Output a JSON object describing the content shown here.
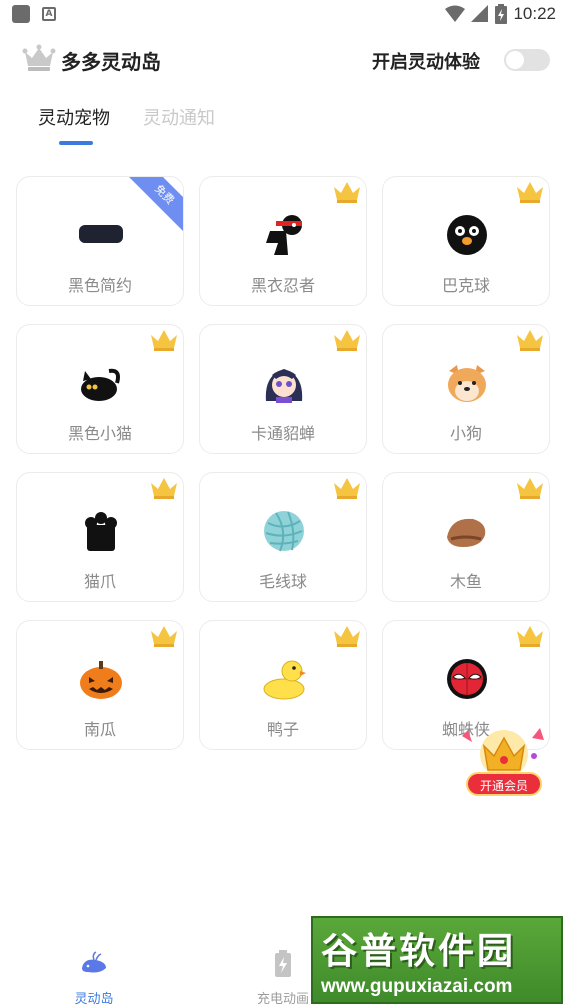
{
  "status_bar": {
    "time": "10:22"
  },
  "header": {
    "title": "多多灵动岛",
    "toggle_label": "开启灵动体验",
    "toggle_on": false
  },
  "tabs": [
    {
      "label": "灵动宠物",
      "active": true
    },
    {
      "label": "灵动通知",
      "active": false
    }
  ],
  "pets": [
    {
      "label": "黑色简约",
      "badge": "免费",
      "icon": "black-pill-icon"
    },
    {
      "label": "黑衣忍者",
      "icon": "ninja-icon",
      "vip": true
    },
    {
      "label": "巴克球",
      "icon": "black-ball-icon",
      "vip": true
    },
    {
      "label": "黑色小猫",
      "icon": "black-cat-icon",
      "vip": true
    },
    {
      "label": "卡通貂蝉",
      "icon": "cartoon-girl-icon",
      "vip": true
    },
    {
      "label": "小狗",
      "icon": "shiba-dog-icon",
      "vip": true
    },
    {
      "label": "猫爪",
      "icon": "cat-paw-icon",
      "vip": true
    },
    {
      "label": "毛线球",
      "icon": "yarn-ball-icon",
      "vip": true
    },
    {
      "label": "木鱼",
      "icon": "wooden-fish-icon",
      "vip": true
    },
    {
      "label": "南瓜",
      "icon": "pumpkin-icon",
      "vip": true
    },
    {
      "label": "鸭子",
      "icon": "duck-icon",
      "vip": true
    },
    {
      "label": "蜘蛛侠",
      "icon": "spiderman-icon",
      "vip": true
    }
  ],
  "vip_promo": {
    "label": "开通会员"
  },
  "bottom_nav": [
    {
      "label": "灵动岛",
      "icon": "whale-icon",
      "active": true
    },
    {
      "label": "充电动画",
      "icon": "battery-charge-icon",
      "active": false
    }
  ],
  "watermark": {
    "title": "谷普软件园",
    "url": "www.gupuxiazai.com"
  },
  "colors": {
    "accent": "#3b7be0",
    "vip_red": "#ea2e3c",
    "crown_gold": "#f5c542"
  }
}
